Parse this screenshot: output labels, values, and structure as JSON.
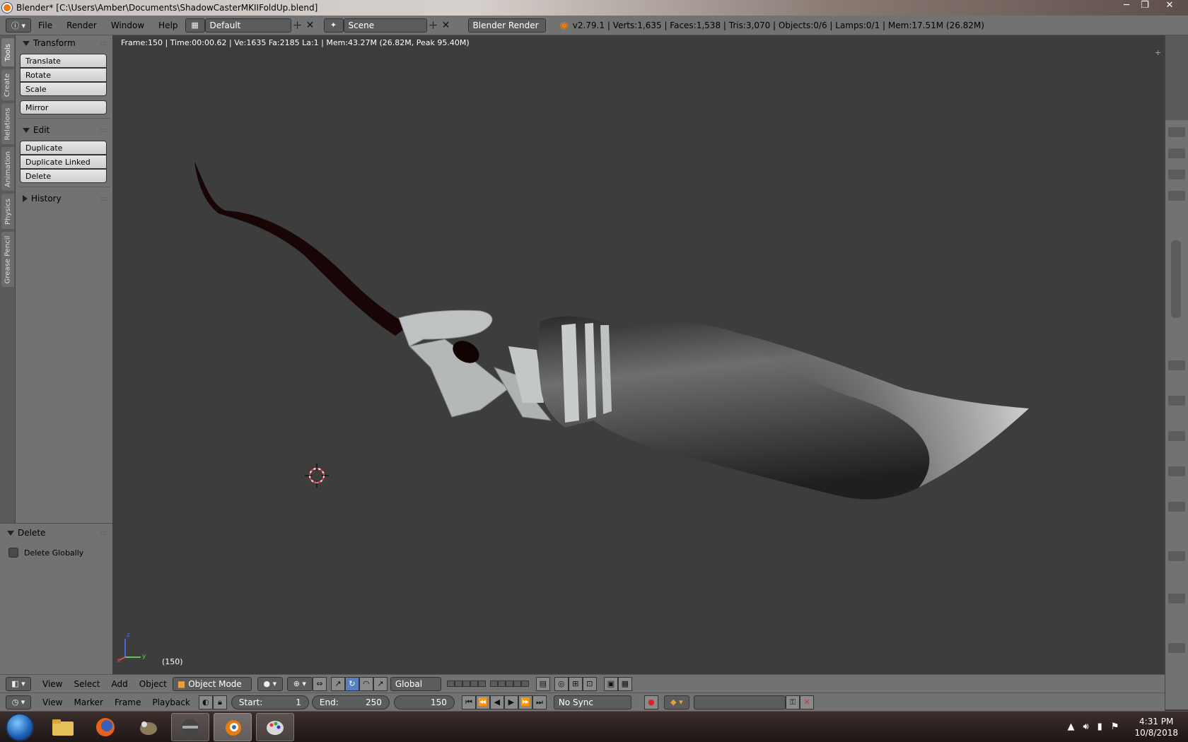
{
  "window": {
    "title": "Blender* [C:\\Users\\Amber\\Documents\\ShadowCasterMKIIFoldUp.blend]",
    "minimize": "─",
    "maximize": "❐",
    "close": "✕"
  },
  "infobar": {
    "menus": [
      "File",
      "Render",
      "Window",
      "Help"
    ],
    "screen_layout": "Default",
    "scene": "Scene",
    "render_engine": "Blender Render",
    "stats": "v2.79.1 | Verts:1,635 | Faces:1,538 | Tris:3,070 | Objects:0/6 | Lamps:0/1 | Mem:17.51M (26.82M)"
  },
  "tool_tabs": [
    "Tools",
    "Create",
    "Relations",
    "Animation",
    "Physics",
    "Grease Pencil"
  ],
  "toolshelf": {
    "transform_title": "Transform",
    "translate": "Translate",
    "rotate": "Rotate",
    "scale": "Scale",
    "mirror": "Mirror",
    "edit_title": "Edit",
    "duplicate": "Duplicate",
    "duplicate_linked": "Duplicate Linked",
    "delete": "Delete",
    "history_title": "History"
  },
  "operator_panel": {
    "title": "Delete",
    "delete_globally": "Delete Globally",
    "delete_globally_checked": false
  },
  "viewport": {
    "info": "Frame:150 | Time:00:00.62 | Ve:1635 Fa:2185 La:1 | Mem:43.27M (26.82M, Peak 95.40M)",
    "frame_label": "(150)",
    "axis_x": "x",
    "axis_y": "y",
    "axis_z": "z"
  },
  "view_header": {
    "menus": [
      "View",
      "Select",
      "Add",
      "Object"
    ],
    "mode": "Object Mode",
    "orientation": "Global"
  },
  "timeline_header": {
    "menus": [
      "View",
      "Marker",
      "Frame",
      "Playback"
    ],
    "start_label": "Start:",
    "start_value": "1",
    "end_label": "End:",
    "end_value": "250",
    "current_frame": "150",
    "sync": "No Sync"
  },
  "taskbar": {
    "time": "4:31 PM",
    "date": "10/8/2018"
  },
  "colors": {
    "ui_gray": "#727272",
    "viewport_bg": "#3d3d3d",
    "accent_orange": "#e87d0d",
    "active_blue": "#5680c2"
  }
}
